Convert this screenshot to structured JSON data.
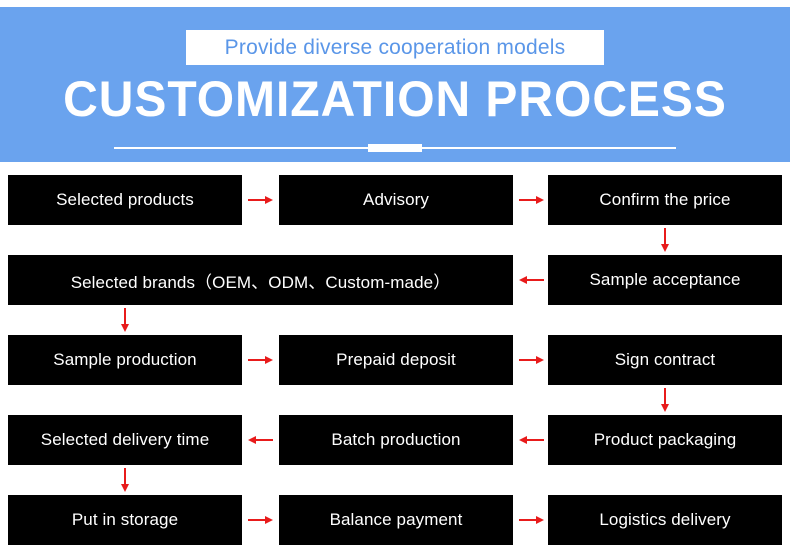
{
  "header": {
    "subtitle": "Provide diverse cooperation models",
    "title": "CUSTOMIZATION PROCESS",
    "banner_color": "#6aa3ee",
    "subtitle_color": "#5a96e8",
    "title_color": "#ffffff"
  },
  "flow": {
    "node_bg": "#000000",
    "node_text_color": "#ffffff",
    "arrow_color": "#e81b1b",
    "nodes": [
      {
        "id": "selected-products",
        "label": "Selected products",
        "row": 1,
        "col": 1
      },
      {
        "id": "advisory",
        "label": "Advisory",
        "row": 1,
        "col": 2
      },
      {
        "id": "confirm-the-price",
        "label": "Confirm the price",
        "row": 1,
        "col": 3
      },
      {
        "id": "selected-brands",
        "label": "Selected brands（OEM、ODM、Custom-made）",
        "row": 2,
        "col": 1,
        "span": 2
      },
      {
        "id": "sample-acceptance",
        "label": "Sample acceptance",
        "row": 2,
        "col": 3
      },
      {
        "id": "sample-production",
        "label": "Sample production",
        "row": 3,
        "col": 1
      },
      {
        "id": "prepaid-deposit",
        "label": "Prepaid deposit",
        "row": 3,
        "col": 2
      },
      {
        "id": "sign-contract",
        "label": "Sign contract",
        "row": 3,
        "col": 3
      },
      {
        "id": "selected-delivery-time",
        "label": "Selected delivery time",
        "row": 4,
        "col": 1
      },
      {
        "id": "batch-production",
        "label": "Batch production",
        "row": 4,
        "col": 2
      },
      {
        "id": "product-packaging",
        "label": "Product packaging",
        "row": 4,
        "col": 3
      },
      {
        "id": "put-in-storage",
        "label": "Put in storage",
        "row": 5,
        "col": 1
      },
      {
        "id": "balance-payment",
        "label": "Balance payment",
        "row": 5,
        "col": 2
      },
      {
        "id": "logistics-delivery",
        "label": "Logistics delivery",
        "row": 5,
        "col": 3
      }
    ],
    "connectors": [
      {
        "id": "selected-products-to-advisory",
        "direction": "right",
        "row": 1
      },
      {
        "id": "advisory-to-confirm-the-price",
        "direction": "right",
        "row": 1
      },
      {
        "id": "confirm-the-price-to-sample-acceptance",
        "direction": "down",
        "row": 1
      },
      {
        "id": "sample-acceptance-to-selected-brands",
        "direction": "left",
        "row": 2
      },
      {
        "id": "selected-brands-to-sample-production",
        "direction": "down",
        "row": 2
      },
      {
        "id": "sample-production-to-prepaid-deposit",
        "direction": "right",
        "row": 3
      },
      {
        "id": "prepaid-deposit-to-sign-contract",
        "direction": "right",
        "row": 3
      },
      {
        "id": "sign-contract-to-product-packaging",
        "direction": "down",
        "row": 3
      },
      {
        "id": "product-packaging-to-batch-production",
        "direction": "left",
        "row": 4
      },
      {
        "id": "batch-production-to-selected-delivery-time",
        "direction": "left",
        "row": 4
      },
      {
        "id": "selected-delivery-time-to-put-in-storage",
        "direction": "down",
        "row": 4
      },
      {
        "id": "put-in-storage-to-balance-payment",
        "direction": "right",
        "row": 5
      },
      {
        "id": "balance-payment-to-logistics-delivery",
        "direction": "right",
        "row": 5
      }
    ]
  }
}
